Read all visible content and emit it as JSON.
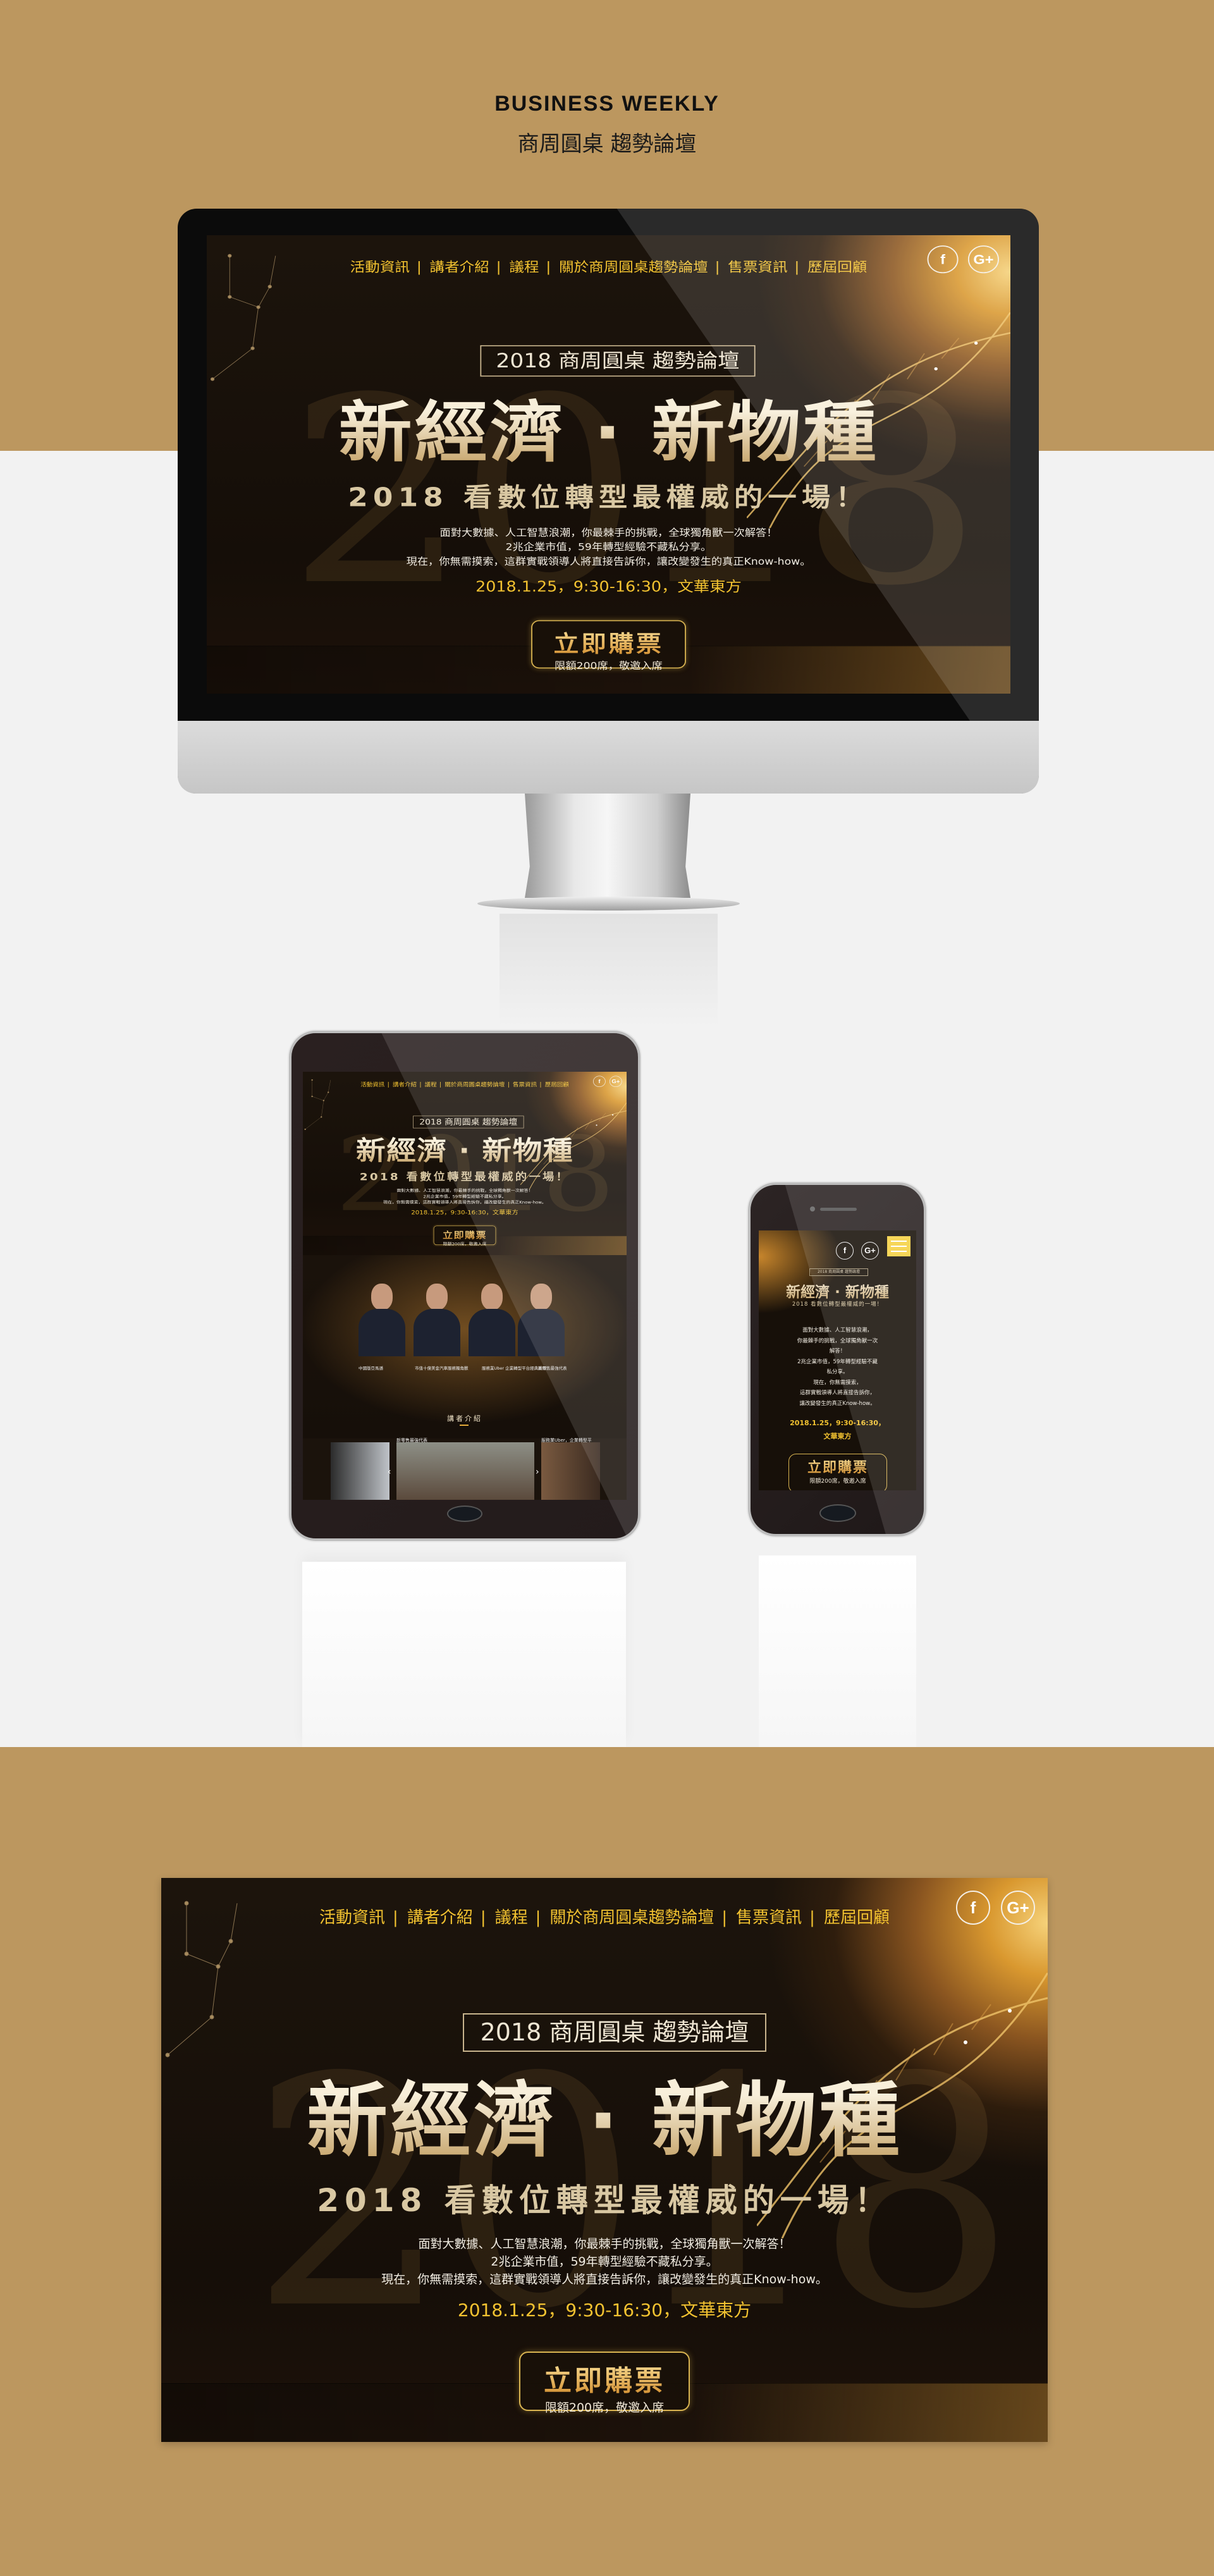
{
  "brand": {
    "title": "BUSINESS  WEEKLY",
    "subtitle": "商周圓桌 趨勢論壇"
  },
  "hero": {
    "nav": [
      "活動資訊",
      "講者介紹",
      "議程",
      "關於商周圓桌趨勢論壇",
      "售票資訊",
      "歷屆回顧"
    ],
    "social": {
      "facebook": "f",
      "googleplus": "G+"
    },
    "badge": "2018 商周圓桌 趨勢論壇",
    "watermark": "2018",
    "title": "新經濟 · 新物種",
    "subtitle": "2018 看數位轉型最權威的一場！",
    "paragraph": [
      "面對大數據、人工智慧浪潮，你最棘手的挑戰，全球獨角獸一次解答！",
      "2兆企業市值，59年轉型經驗不藏私分享。",
      "現在，你無需摸索，這群實戰領導人將直接告訴你，讓改變發生的真正Know-how。"
    ],
    "date": "2018.1.25，9:30-16:30，文華東方",
    "cta": {
      "label": "立即購票",
      "sub": "限額200席，敬邀入席"
    }
  },
  "mobile": {
    "paragraph": [
      "面對大數據、人工智慧浪潮，",
      "你最棘手的挑戰，全球獨角獸一次",
      "解答！",
      "2兆企業市值，59年轉型經驗不藏",
      "私分享。",
      "現在，你無需摸索，",
      "這群實戰領導人將直接告訴你，",
      "讓改變發生的真正Know-how。"
    ],
    "date": [
      "2018.1.25，9:30-16:30，",
      "文華東方"
    ]
  },
  "speakers": {
    "heading": "講者介紹",
    "items": [
      {
        "caption": "中國版亞馬遜"
      },
      {
        "caption": "市值十億美金汽車服務獨角獸"
      },
      {
        "caption": "服務業Uber 企業轉型平台經典案例"
      },
      {
        "caption": "新零售最強代表"
      }
    ],
    "carousel": {
      "center_caption": "新零售最強代表",
      "right_caption": "服務業Uber，企業轉型平"
    }
  },
  "colors": {
    "gold_band": "#bc975f",
    "nav_yellow": "#f2c230",
    "background": "#f2f2f2"
  }
}
